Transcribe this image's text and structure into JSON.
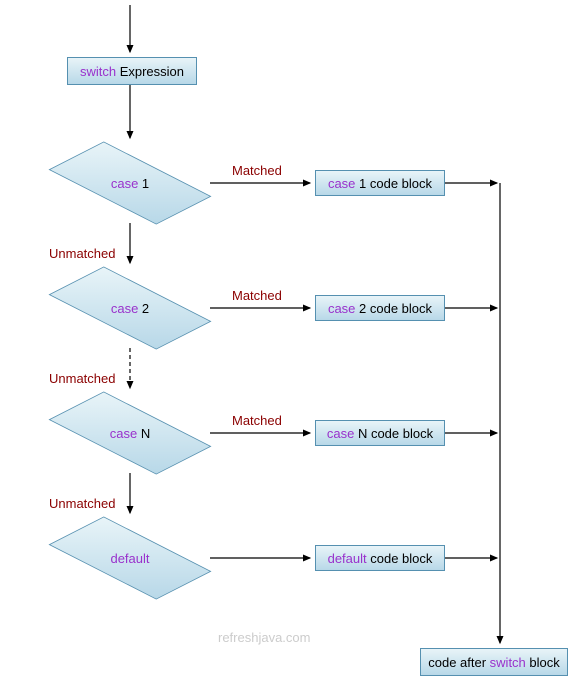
{
  "diagram": {
    "start_box": {
      "kw": "switch",
      "text": " Expression"
    },
    "cases": [
      {
        "kw": "case",
        "label": " 1",
        "block_kw": "case",
        "block_text": " 1 code block",
        "matched": "Matched",
        "unmatched": "Unmatched"
      },
      {
        "kw": "case",
        "label": " 2",
        "block_kw": "case",
        "block_text": " 2 code block",
        "matched": "Matched",
        "unmatched": "Unmatched"
      },
      {
        "kw": "case",
        "label": " N",
        "block_kw": "case",
        "block_text": " N code block",
        "matched": "Matched",
        "unmatched": "Unmatched"
      }
    ],
    "default": {
      "kw": "default",
      "block_kw": "default",
      "block_text": " code block"
    },
    "end_box": {
      "pre": "code after ",
      "kw": "switch",
      "post": " block"
    },
    "watermark": "refreshjava.com"
  },
  "chart_data": {
    "type": "flowchart",
    "title": "switch statement control flow",
    "nodes": [
      {
        "id": "start",
        "shape": "process",
        "text": "switch Expression"
      },
      {
        "id": "c1",
        "shape": "decision",
        "text": "case 1"
      },
      {
        "id": "b1",
        "shape": "process",
        "text": "case 1 code block"
      },
      {
        "id": "c2",
        "shape": "decision",
        "text": "case 2"
      },
      {
        "id": "b2",
        "shape": "process",
        "text": "case 2 code block"
      },
      {
        "id": "cN",
        "shape": "decision",
        "text": "case N"
      },
      {
        "id": "bN",
        "shape": "process",
        "text": "case N code block"
      },
      {
        "id": "def",
        "shape": "decision",
        "text": "default"
      },
      {
        "id": "bdef",
        "shape": "process",
        "text": "default code block"
      },
      {
        "id": "end",
        "shape": "process",
        "text": "code after switch block"
      }
    ],
    "edges": [
      {
        "from": "start",
        "to": "c1",
        "label": ""
      },
      {
        "from": "c1",
        "to": "b1",
        "label": "Matched"
      },
      {
        "from": "c1",
        "to": "c2",
        "label": "Unmatched"
      },
      {
        "from": "c2",
        "to": "b2",
        "label": "Matched"
      },
      {
        "from": "c2",
        "to": "cN",
        "label": "Unmatched",
        "style": "dashed"
      },
      {
        "from": "cN",
        "to": "bN",
        "label": "Matched"
      },
      {
        "from": "cN",
        "to": "def",
        "label": "Unmatched"
      },
      {
        "from": "def",
        "to": "bdef",
        "label": ""
      },
      {
        "from": "b1",
        "to": "end",
        "label": ""
      },
      {
        "from": "b2",
        "to": "end",
        "label": ""
      },
      {
        "from": "bN",
        "to": "end",
        "label": ""
      },
      {
        "from": "bdef",
        "to": "end",
        "label": ""
      }
    ]
  }
}
